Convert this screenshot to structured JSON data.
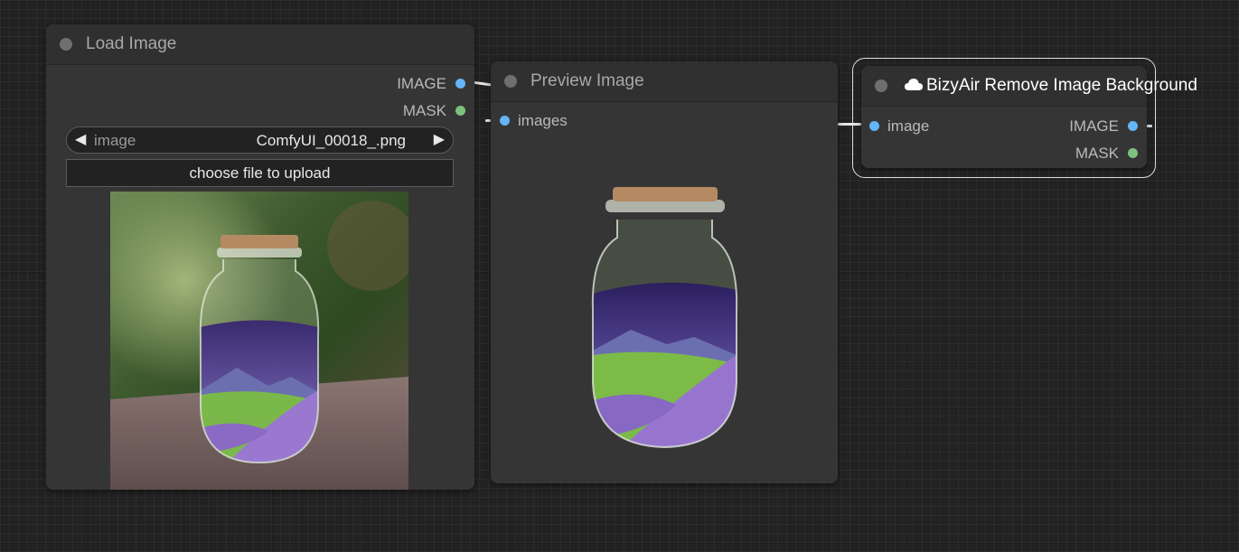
{
  "load_node": {
    "title": "Load Image",
    "outputs": [
      {
        "label": "IMAGE",
        "color": "#64b5f6"
      },
      {
        "label": "MASK",
        "color": "#7cc27e"
      }
    ],
    "combo_name": "image",
    "combo_value": "ComfyUI_00018_.png",
    "upload_label": "choose file to upload"
  },
  "preview_node": {
    "title": "Preview Image",
    "input_label": "images"
  },
  "bizy_node": {
    "title": "BizyAir Remove Image Background",
    "icon": "cloud-icon",
    "input_label": "image",
    "outputs": [
      {
        "label": "IMAGE",
        "color": "#64b5f6"
      },
      {
        "label": "MASK",
        "color": "#7cc27e"
      }
    ]
  },
  "colors": {
    "canvas": "#222222",
    "node": "#353535",
    "link": "#e8e8e8"
  }
}
